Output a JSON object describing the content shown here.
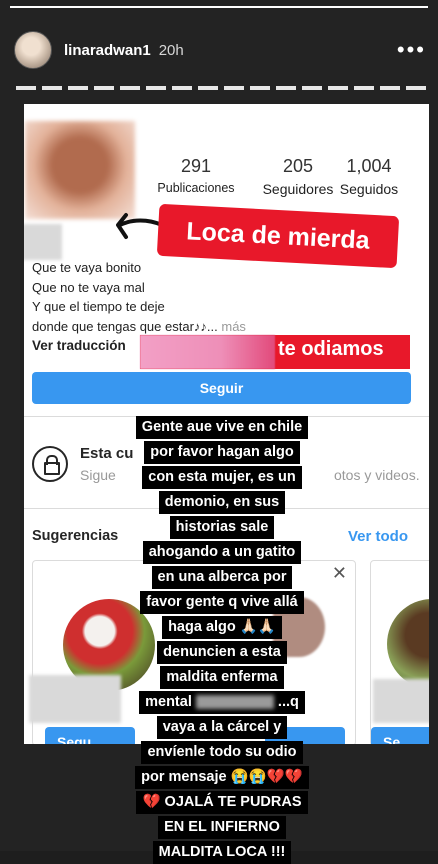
{
  "story": {
    "username": "linaradwan1",
    "time_ago": "20h",
    "progress": 1.0
  },
  "profile": {
    "stats": [
      {
        "value": "291",
        "label": "Publicaciones"
      },
      {
        "value": "205",
        "label": "Seguidores"
      },
      {
        "value": "1,004",
        "label": "Seguidos"
      }
    ],
    "bio_lines": [
      "Que te vaya bonito",
      "Que no te vaya mal",
      "Y que el tiempo te deje"
    ],
    "bio_last": "donde que tengas que estar♪♪...",
    "bio_more": "más",
    "translate_label": "Ver traducción",
    "follow_button": "Seguir"
  },
  "private_account": {
    "title": "Esta cu",
    "subtitle_start": "Sigue",
    "subtitle_end": "otos y videos."
  },
  "suggestions": {
    "title": "Sugerencias",
    "see_all": "Ver todo",
    "card_buttons": [
      "Segu",
      "Se"
    ]
  },
  "stickers": {
    "insult": "Loca de mierda",
    "hate": "te odiamos"
  },
  "caption_lines": [
    "Gente aue vive en chile",
    "por favor hagan algo",
    "con esta mujer, es un",
    "demonio, en sus",
    "historias sale",
    "ahogando a un gatito",
    "en una alberca por",
    "favor gente q vive allá",
    "haga algo 🙏🏻🙏🏻",
    "denuncien a esta",
    "maldita enferma",
    "vaya a la cárcel y",
    "envíenle todo su odio",
    "por mensaje 😭😭💔💔",
    "💔 OJALÁ TE PUDRAS",
    "EN EL INFIERNO",
    "MALDITA LOCA !!!"
  ],
  "caption_mental": {
    "before": "mental",
    "after": "...q"
  }
}
